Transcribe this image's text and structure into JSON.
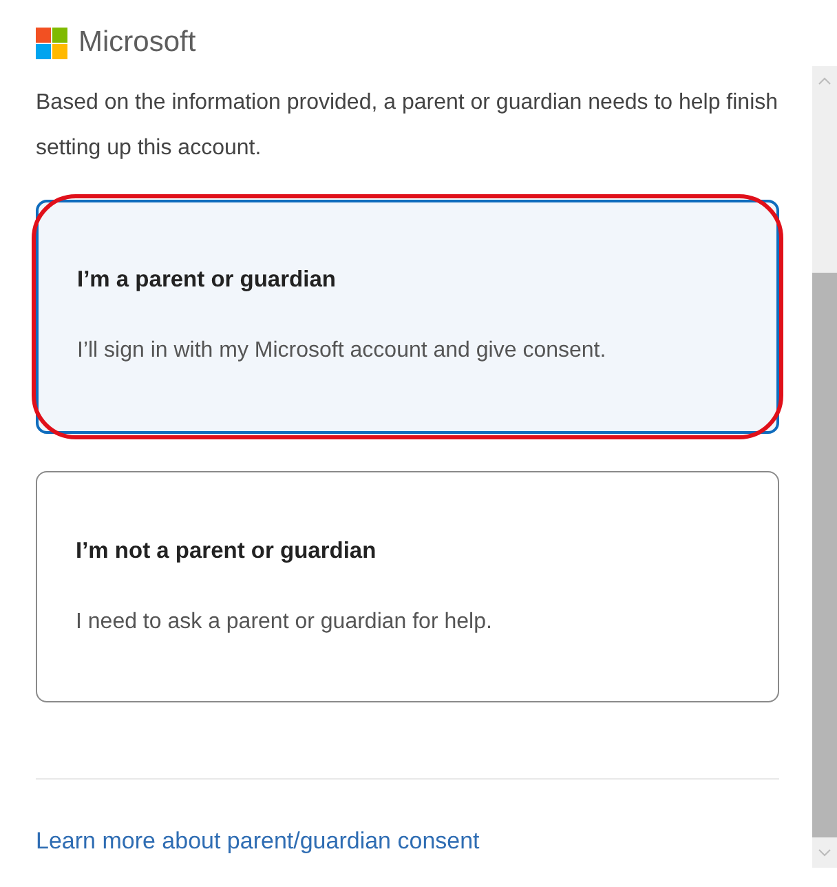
{
  "brand": {
    "name": "Microsoft"
  },
  "message": "Based on the information provided, a parent or guardian needs to help finish setting up this account.",
  "options": [
    {
      "title": "I’m a parent or guardian",
      "description": "I’ll sign in with my Microsoft account and give consent.",
      "selected": true,
      "highlighted": true
    },
    {
      "title": "I’m not a parent or guardian",
      "description": "I need to ask a parent or guardian for help.",
      "selected": false,
      "highlighted": false
    }
  ],
  "link": "Learn more about parent/guardian consent"
}
